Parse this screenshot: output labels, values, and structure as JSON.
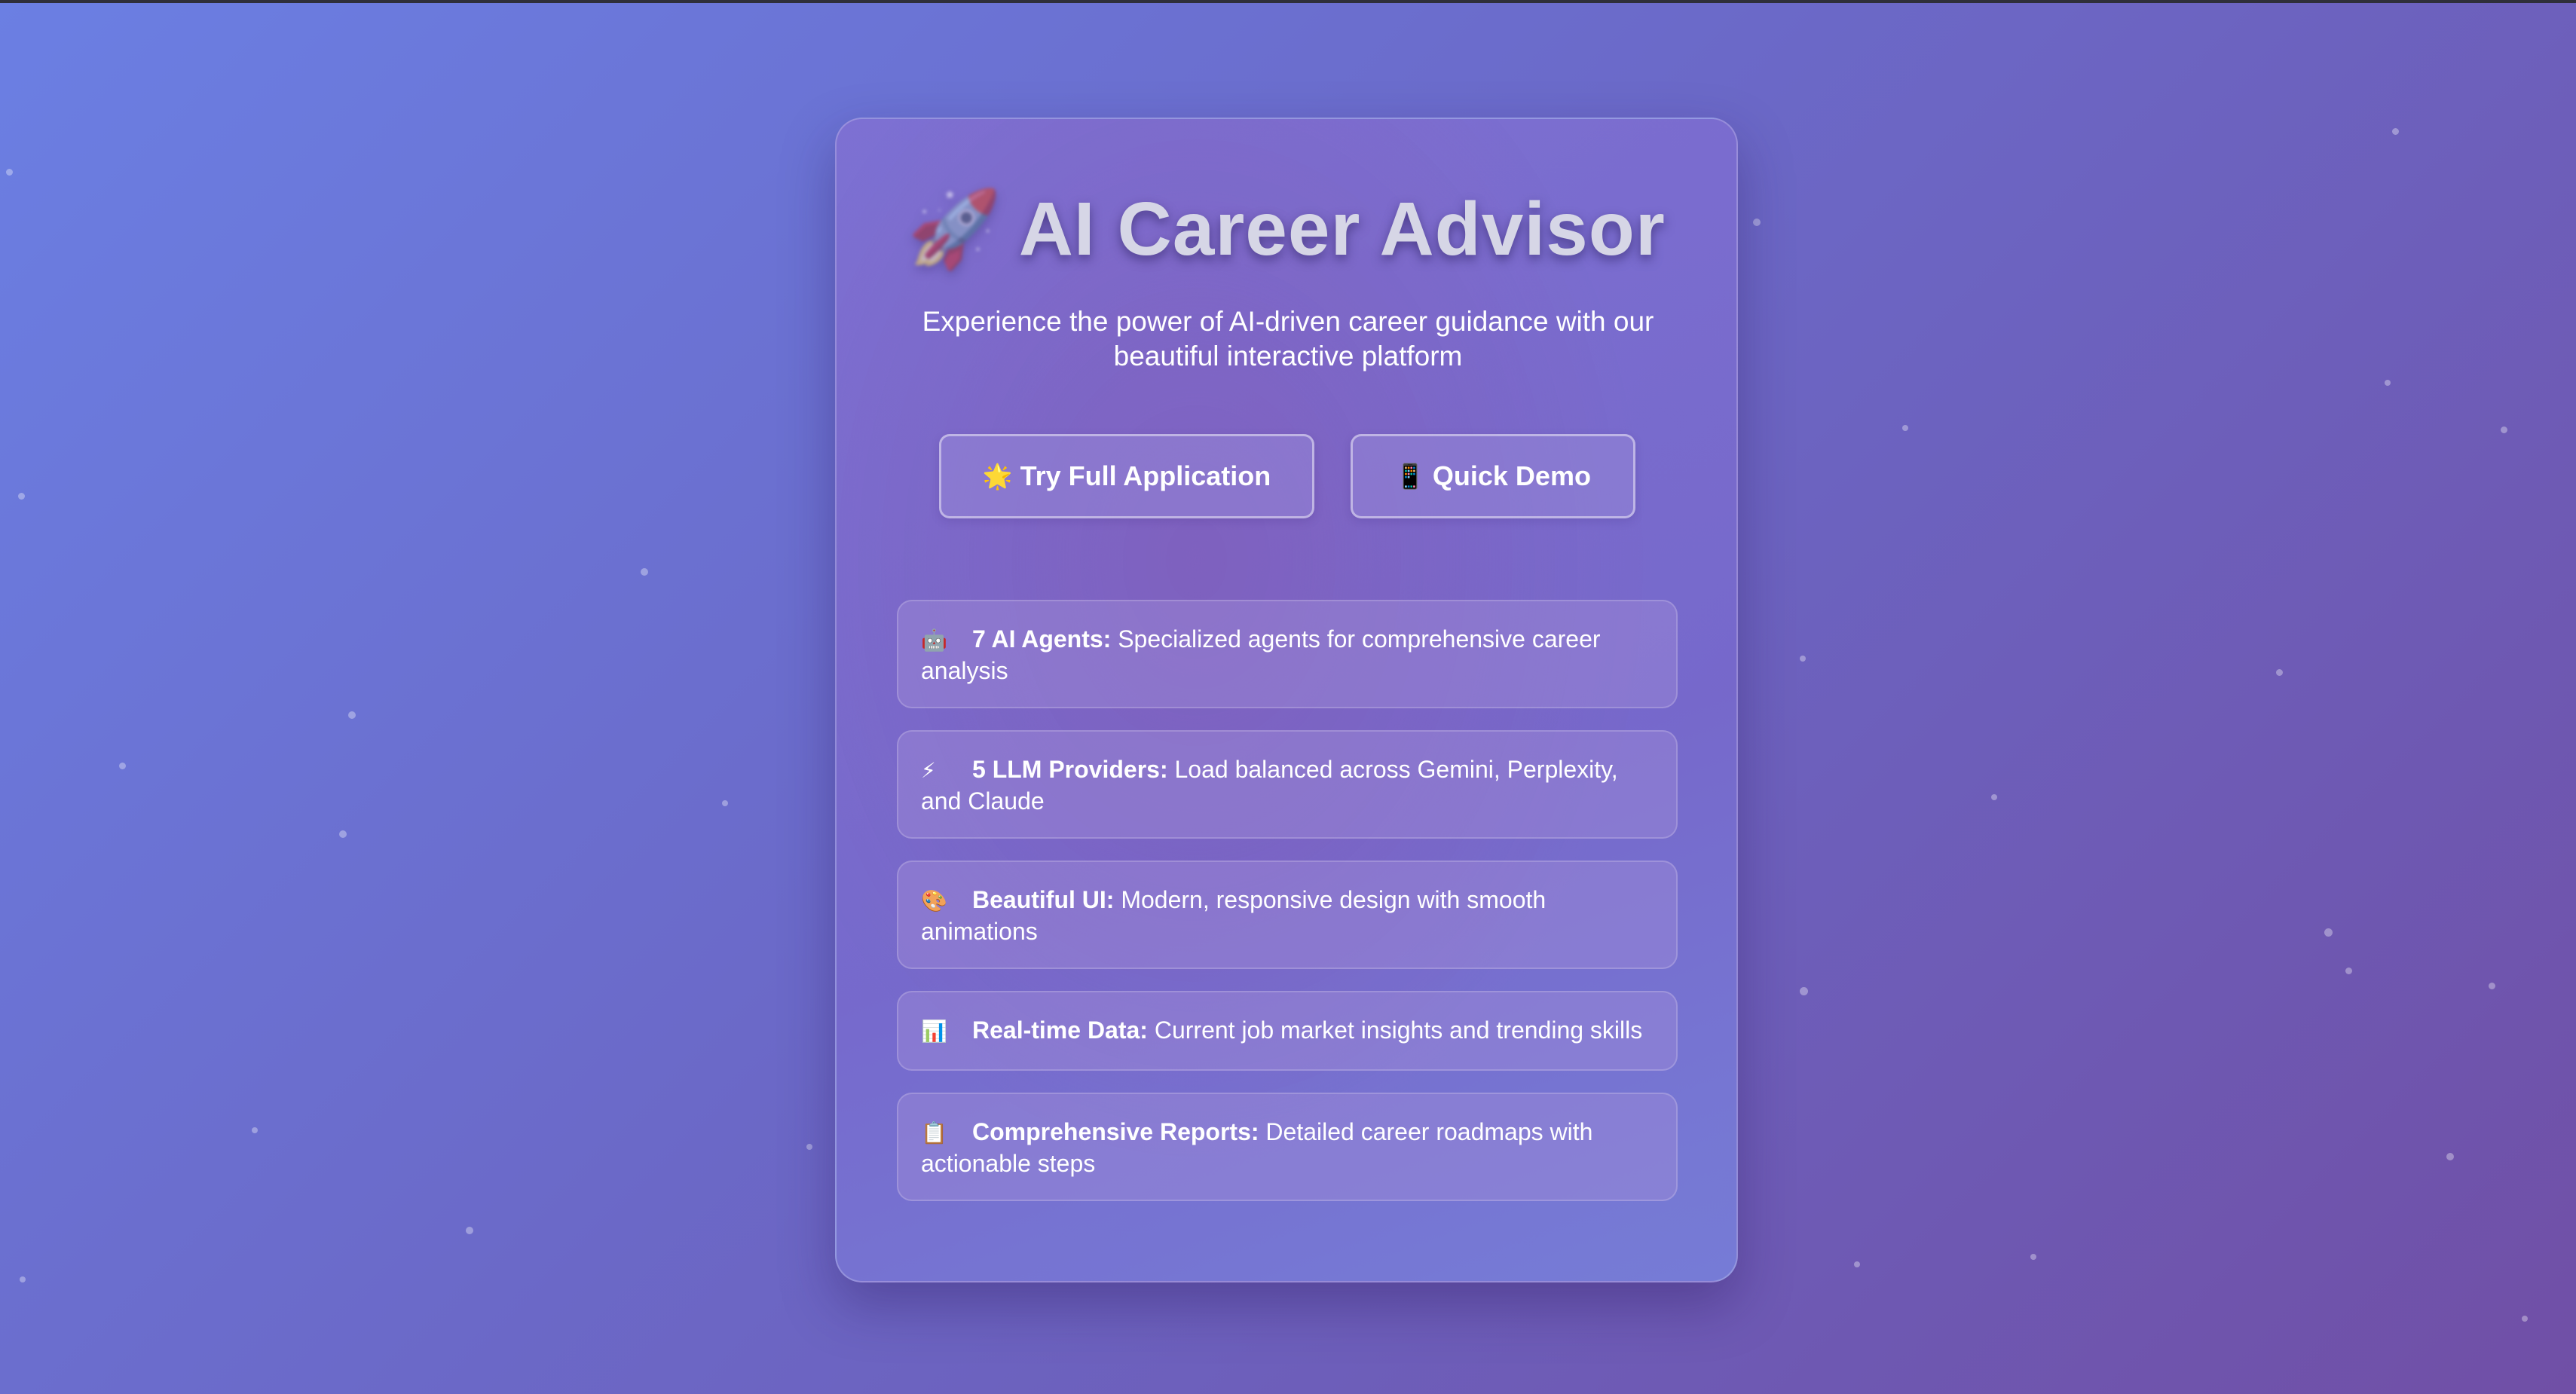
{
  "app": {
    "title": "AI Career Advisor",
    "title_icon": "rocket-icon",
    "subtitle": "Experience the power of AI-driven career guidance with our beautiful interactive platform"
  },
  "buttons": {
    "full_app": {
      "icon": "🌟",
      "icon_name": "star-icon",
      "label": "Try Full Application"
    },
    "quick_demo": {
      "icon": "📱",
      "icon_name": "phone-icon",
      "label": "Quick Demo"
    }
  },
  "features": [
    {
      "icon": "🤖",
      "icon_name": "robot-icon",
      "title": "7 AI Agents:",
      "text": "Specialized agents for comprehensive career analysis"
    },
    {
      "icon": "⚡",
      "icon_name": "lightning-icon",
      "title": "5 LLM Providers:",
      "text": "Load balanced across Gemini, Perplexity, and Claude"
    },
    {
      "icon": "🎨",
      "icon_name": "palette-icon",
      "title": "Beautiful UI:",
      "text": "Modern, responsive design with smooth animations"
    },
    {
      "icon": "📊",
      "icon_name": "bar-chart-icon",
      "title": "Real-time Data:",
      "text": "Current job market insights and trending skills"
    },
    {
      "icon": "📋",
      "icon_name": "clipboard-icon",
      "title": "Comprehensive Reports:",
      "text": "Detailed career roadmaps with actionable steps"
    }
  ],
  "colors": {
    "background_start": "#6b7fe3",
    "background_end": "#704fa6",
    "text": "#ffffff",
    "title": "#d6d6e6"
  }
}
